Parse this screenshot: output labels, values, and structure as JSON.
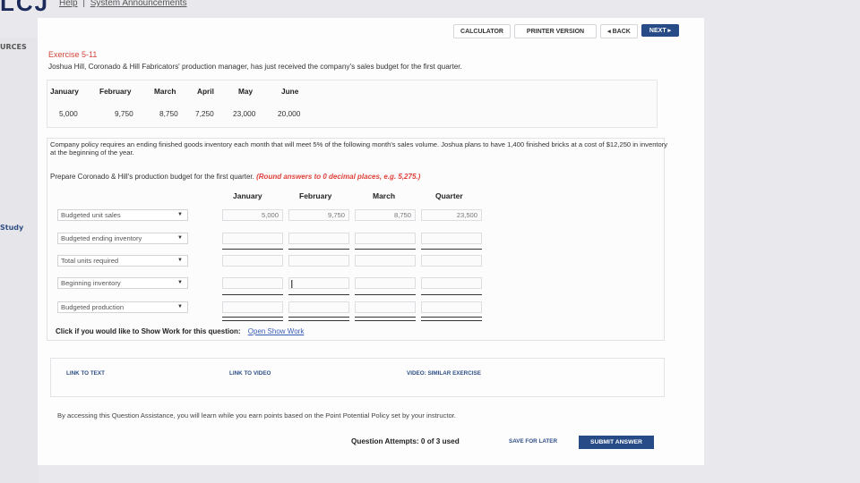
{
  "header": {
    "logo_text": "LCJ",
    "links": [
      "Help",
      "System Announcements"
    ],
    "separator": "|"
  },
  "sidebar": {
    "label_top": "URCES",
    "label_study": "Study"
  },
  "toolbar": {
    "calculator": "CALCULATOR",
    "printer": "PRINTER VERSION",
    "back": "◂ BACK",
    "next": "NEXT ▸"
  },
  "exercise": {
    "title": "Exercise 5-11",
    "intro": "Joshua Hill, Coronado & Hill Fabricators' production manager, has just received the company's sales budget for the first quarter.",
    "months": [
      "January",
      "February",
      "March",
      "April",
      "May",
      "June"
    ],
    "sales": [
      "5,000",
      "9,750",
      "8,750",
      "7,250",
      "23,000",
      "20,000"
    ],
    "policy": "Company policy requires an ending finished goods inventory each month that will meet 5% of the following month's sales volume. Joshua plans to have 1,400 finished bricks at a cost of $12,250 in inventory at the beginning of the year.",
    "prepare": "Prepare Coronado & Hill's production budget for the first quarter.",
    "prepare_note": "(Round answers to 0 decimal places, e.g. 5,275.)"
  },
  "budget": {
    "columns": [
      "January",
      "February",
      "March",
      "Quarter"
    ],
    "rows": [
      {
        "label": "Budgeted unit sales",
        "values": [
          "5,000",
          "9,750",
          "8,750",
          "23,500"
        ]
      },
      {
        "label": "Budgeted ending inventory",
        "values": [
          "",
          "",
          "",
          ""
        ]
      },
      {
        "label": "Total units required",
        "values": [
          "",
          "",
          "",
          ""
        ]
      },
      {
        "label": "Beginning inventory",
        "values": [
          "",
          "",
          "",
          ""
        ]
      },
      {
        "label": "Budgeted production",
        "values": [
          "",
          "",
          "",
          ""
        ]
      }
    ]
  },
  "showwork": {
    "prompt": "Click if you would like to Show Work for this question:",
    "link": "Open Show Work"
  },
  "assistance": {
    "link_text": "LINK TO TEXT",
    "link_video": "LINK TO VIDEO",
    "similar": "VIDEO: SIMILAR EXERCISE",
    "note": "By accessing this Question Assistance, you will learn while you earn points based on the Point Potential Policy set by your instructor."
  },
  "footer": {
    "attempts": "Question Attempts: 0 of 3 used",
    "save_later": "SAVE FOR LATER",
    "submit": "SUBMIT ANSWER"
  }
}
